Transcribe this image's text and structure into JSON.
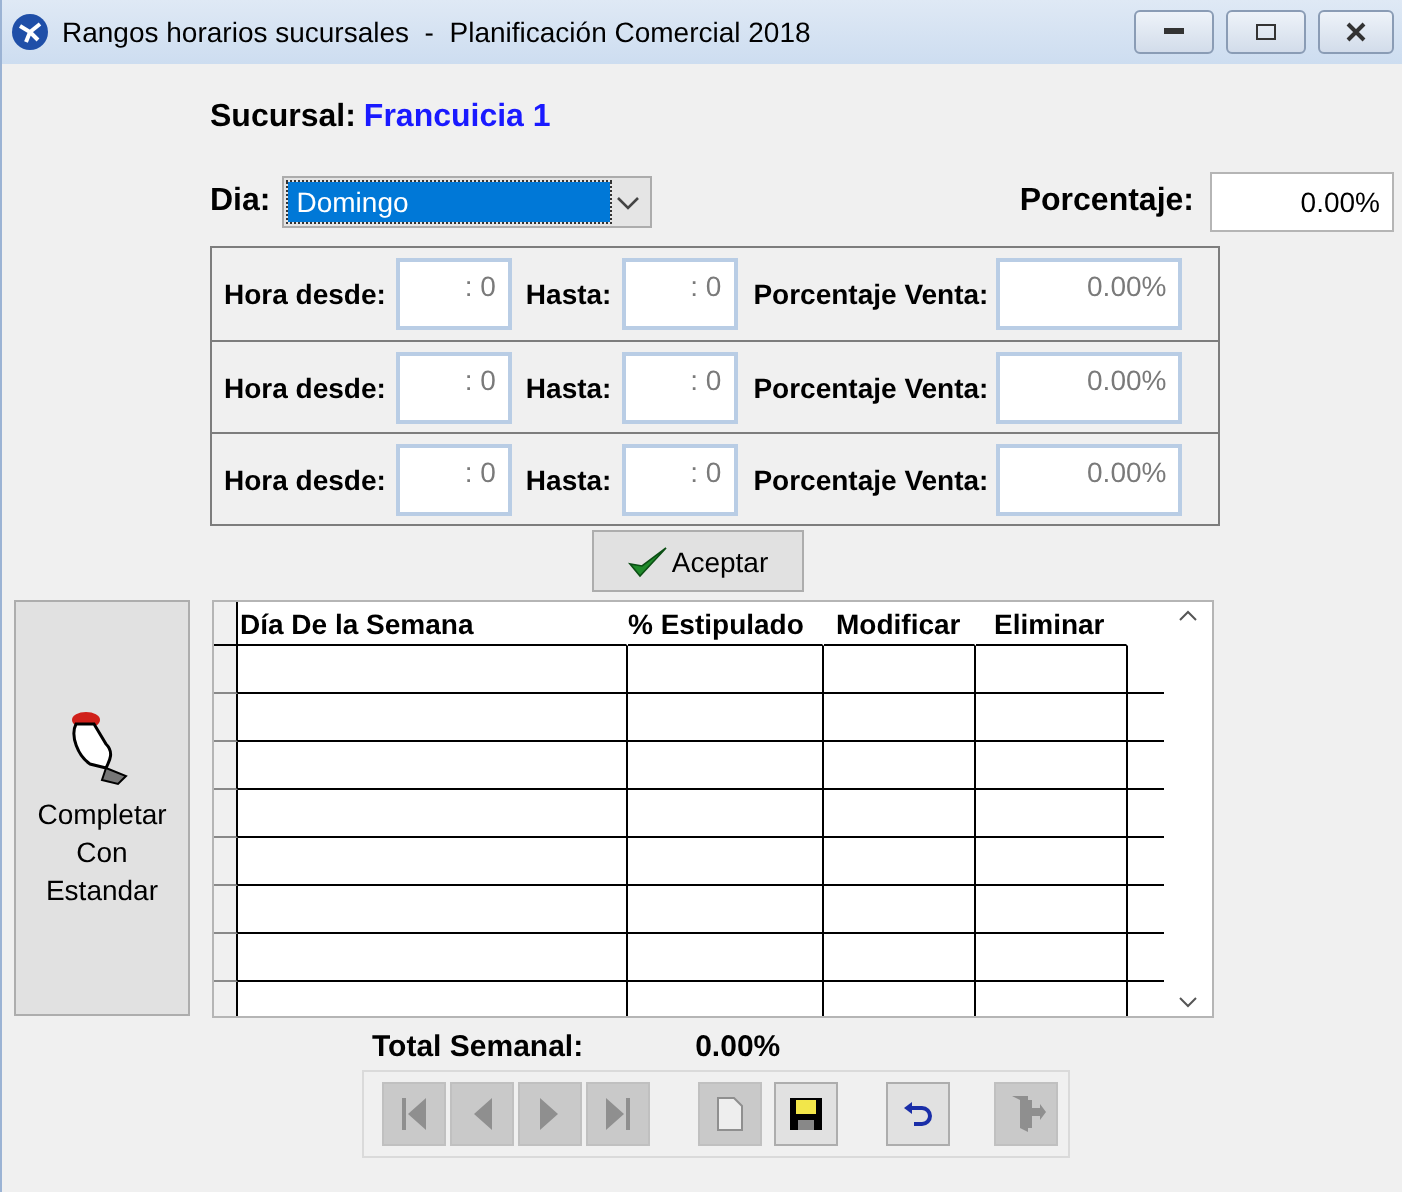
{
  "window": {
    "title": "Rangos horarios sucursales  -  Planificación Comercial 2018"
  },
  "sucursal": {
    "label": "Sucursal:",
    "value": "Francuicia 1"
  },
  "dia": {
    "label": "Dia:",
    "value": "Domingo"
  },
  "porcentaje": {
    "label": "Porcentaje:",
    "value": "0.00%"
  },
  "ranges": [
    {
      "from_label": "Hora desde:",
      "from": ": 0",
      "to_label": "Hasta:",
      "to": ": 0",
      "pct_label": "Porcentaje Venta:",
      "pct": "0.00%"
    },
    {
      "from_label": "Hora desde:",
      "from": ": 0",
      "to_label": "Hasta:",
      "to": ": 0",
      "pct_label": "Porcentaje Venta:",
      "pct": "0.00%"
    },
    {
      "from_label": "Hora desde:",
      "from": ": 0",
      "to_label": "Hasta:",
      "to": ": 0",
      "pct_label": "Porcentaje Venta:",
      "pct": "0.00%"
    }
  ],
  "accept_button": "Aceptar",
  "standard_button": "Completar Con Estandar",
  "table": {
    "columns": [
      "Día De la Semana",
      "% Estipulado",
      "Modificar",
      "Eliminar"
    ]
  },
  "total": {
    "label": "Total Semanal:",
    "value": "0.00%"
  },
  "toolbar": [
    {
      "kind": "first",
      "disabled": true
    },
    {
      "kind": "prev",
      "disabled": true
    },
    {
      "kind": "next",
      "disabled": true
    },
    {
      "kind": "last",
      "disabled": true
    },
    {
      "kind": "new",
      "disabled": true
    },
    {
      "kind": "save",
      "disabled": false
    },
    {
      "kind": "undo",
      "disabled": false
    },
    {
      "kind": "exit",
      "disabled": true
    }
  ]
}
